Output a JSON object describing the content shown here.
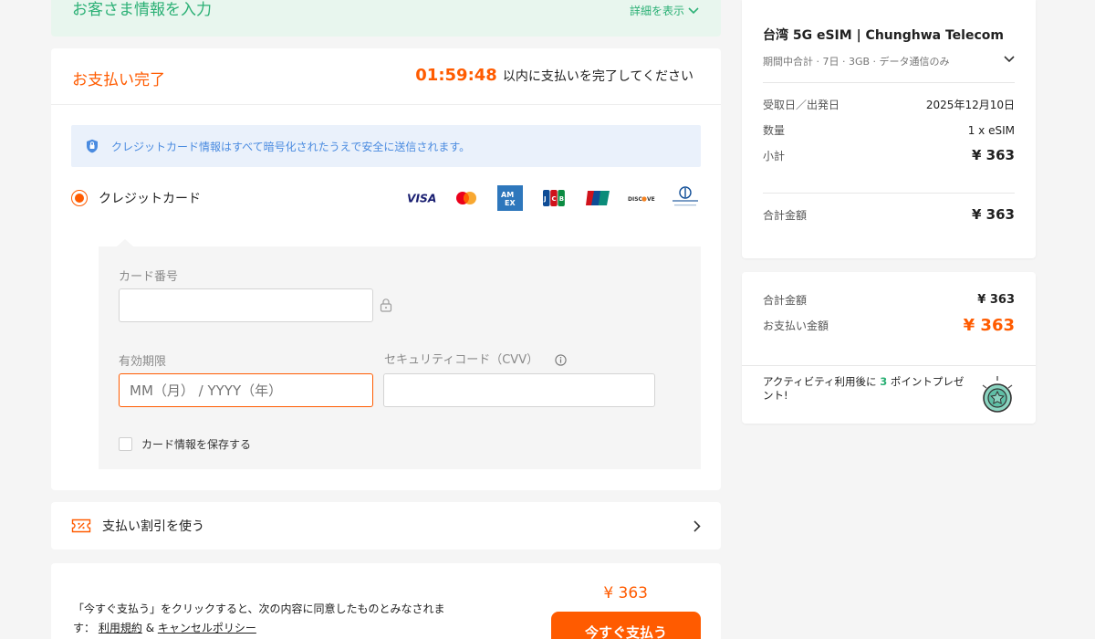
{
  "customer": {
    "title": "お客さま情報を入力",
    "detail_label": "詳細を表示"
  },
  "payment": {
    "title": "お支払い完了",
    "timer": "01:59:48",
    "timer_suffix": "以内に支払いを完了してください",
    "secure_note": "クレジットカード情報はすべて暗号化されたうえで安全に送信されます。",
    "method_label": "クレジットカード",
    "card_logos": [
      "visa-logo",
      "mastercard-logo",
      "amex-logo",
      "jcb-logo",
      "unionpay-logo",
      "discover-logo",
      "diners-club-logo"
    ],
    "card_number_label": "カード番号",
    "card_number_value": "",
    "expiry_label": "有効期限",
    "expiry_placeholder": "MM（月） / YYYY（年）",
    "cvv_label": "セキュリティコード（CVV）",
    "cvv_value": "",
    "save_card_label": "カード情報を保存する"
  },
  "discount": {
    "label": "支払い割引を使う"
  },
  "checkout": {
    "price": "¥ 363",
    "agree_text": "「今すぐ支払う」をクリックすると、次の内容に同意したものとみなされます：",
    "terms_link": "利用規約",
    "and": "&",
    "cancel_link": "キャンセルポリシー",
    "button_label": "今すぐ支払う"
  },
  "summary": {
    "product_title": "台湾 5G eSIM | Chunghwa Telecom",
    "product_sub": "期間中合計 · 7日 · 3GB · データ通信のみ",
    "rows": [
      {
        "label": "受取日／出発日",
        "value": "2025年12月10日"
      },
      {
        "label": "数量",
        "value": "1 x eSIM"
      },
      {
        "label": "小計",
        "value": "¥ 363"
      }
    ],
    "total_label": "合計金額",
    "total_value": "¥ 363"
  },
  "totals": {
    "total_label": "合計金額",
    "total_value": "¥ 363",
    "pay_label": "お支払い金額",
    "pay_value": "¥ 363",
    "points_prefix": "アクティビティ利用後に",
    "points_value": "3",
    "points_suffix": "ポイントプレゼント!"
  },
  "colors": {
    "accent": "#ff5b00",
    "green": "#2bb075",
    "secure_blue": "#4a8be0"
  }
}
